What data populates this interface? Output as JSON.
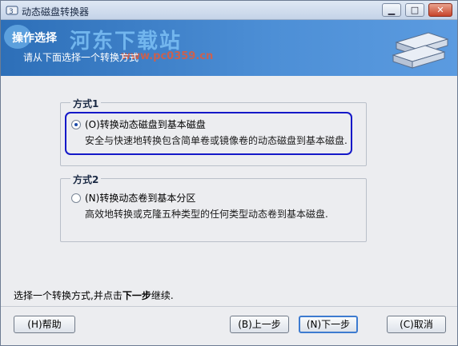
{
  "window": {
    "title": "动态磁盘转换器",
    "minimize": "▁",
    "maximize": "□",
    "close": "✕"
  },
  "banner": {
    "title": "操作选择",
    "subtitle": "请从下面选择一个转换方式",
    "watermark": "河东下载站",
    "watermark_url": "www.pc0359.cn"
  },
  "groups": [
    {
      "legend": "方式1",
      "option_label": "(O)转换动态磁盘到基本磁盘",
      "description": "安全与快速地转换包含简单卷或镜像卷的动态磁盘到基本磁盘.",
      "checked": true
    },
    {
      "legend": "方式2",
      "option_label": "(N)转换动态卷到基本分区",
      "description": "高效地转换或克隆五种类型的任何类型动态卷到基本磁盘.",
      "checked": false
    }
  ],
  "instruction": {
    "prefix": "选择一个转换方式,并点击",
    "bold": "下一步",
    "suffix": "继续."
  },
  "buttons": {
    "help": "(H)帮助",
    "back": "(B)上一步",
    "next": "(N)下一步",
    "cancel": "(C)取消"
  },
  "colors": {
    "banner": "#4d8fd6",
    "focus_ring": "#1418c8"
  }
}
